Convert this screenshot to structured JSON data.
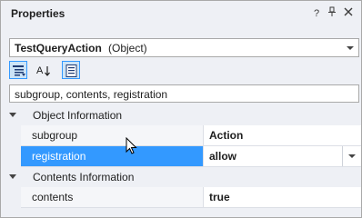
{
  "window": {
    "title": "Properties",
    "buttons": [
      "?",
      "✚",
      "✕"
    ]
  },
  "selector": {
    "object_name": "TestQueryAction",
    "object_type": "(Object)"
  },
  "toolbar": {
    "tools": [
      "categorized-icon",
      "alphabetical-icon",
      "property-pages-icon"
    ]
  },
  "search": {
    "value": "subgroup, contents, registration"
  },
  "categories": [
    {
      "label": "Object Information",
      "properties": [
        {
          "name": "subgroup",
          "value": "Action"
        },
        {
          "name": "registration",
          "value": "allow"
        }
      ]
    },
    {
      "label": "Contents Information",
      "properties": [
        {
          "name": "contents",
          "value": "true"
        }
      ]
    }
  ],
  "colors": {
    "selection": "#3399ff",
    "panel_bg": "#eef0f5"
  }
}
